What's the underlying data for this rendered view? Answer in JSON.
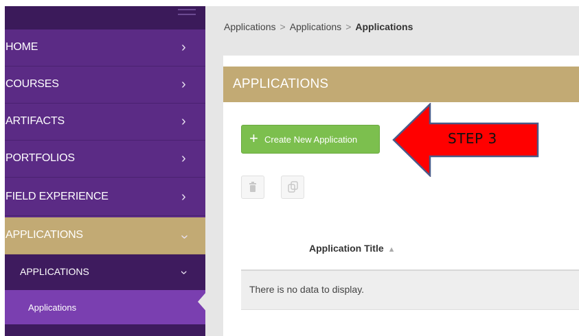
{
  "sidebar": {
    "items": [
      {
        "label": "HOME"
      },
      {
        "label": "COURSES"
      },
      {
        "label": "ARTIFACTS"
      },
      {
        "label": "PORTFOLIOS"
      },
      {
        "label": "FIELD EXPERIENCE"
      },
      {
        "label": "APPLICATIONS"
      }
    ],
    "submenu": {
      "label": "APPLICATIONS"
    },
    "leaf": {
      "label": "Applications"
    }
  },
  "breadcrumb": {
    "items": [
      "Applications",
      "Applications",
      "Applications"
    ],
    "separator": ">"
  },
  "panel": {
    "title": "APPLICATIONS"
  },
  "toolbar": {
    "create_label": "Create New Application",
    "create_icon": "+"
  },
  "table": {
    "columns": [
      {
        "label": "Application Title",
        "sort": "▲"
      }
    ],
    "empty_message": "There is no data to display."
  },
  "annotation": {
    "label": "STEP 3",
    "color": "#ff0000"
  },
  "colors": {
    "sidebar": "#5b2b85",
    "accent": "#c2aa74",
    "button": "#7cbf4e"
  }
}
